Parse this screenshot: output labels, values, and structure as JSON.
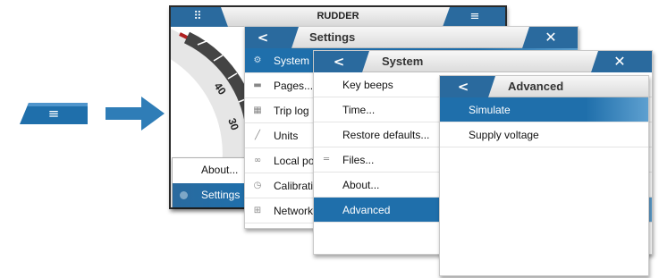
{
  "colors": {
    "accent": "#1f6fab",
    "arrow": "#2f7db7"
  },
  "menu_button": {
    "icon": "menu-icon",
    "glyph": "≡"
  },
  "rudder": {
    "title": "RUDDER",
    "grid_glyph": "⠿",
    "menu_glyph": "≡",
    "gauge_ticks": [
      "40",
      "30"
    ]
  },
  "popup": {
    "items": [
      {
        "label": "About..."
      },
      {
        "label": "Settings"
      }
    ]
  },
  "settings": {
    "title": "Settings",
    "back_glyph": "<",
    "close_glyph": "✕",
    "items": [
      {
        "label": "System",
        "icon": "gear-icon",
        "glyph": "⚙"
      },
      {
        "label": "Pages...",
        "icon": "pages-icon",
        "glyph": "▬"
      },
      {
        "label": "Trip log",
        "icon": "trip-log-icon",
        "glyph": "▦"
      },
      {
        "label": "Units",
        "icon": "ruler-icon",
        "glyph": "╱"
      },
      {
        "label": "Local po",
        "icon": "link-icon",
        "glyph": "∞"
      },
      {
        "label": "Calibratio",
        "icon": "clock-icon",
        "glyph": "◷"
      },
      {
        "label": "Network",
        "icon": "network-icon",
        "glyph": "⊞"
      }
    ]
  },
  "system": {
    "title": "System",
    "back_glyph": "<",
    "close_glyph": "✕",
    "items": [
      {
        "label": "Key beeps",
        "glyph": ""
      },
      {
        "label": "Time...",
        "glyph": ""
      },
      {
        "label": "Restore defaults...",
        "glyph": ""
      },
      {
        "label": "Files...",
        "glyph": "═"
      },
      {
        "label": "About...",
        "glyph": ""
      },
      {
        "label": "Advanced",
        "glyph": ""
      }
    ]
  },
  "advanced": {
    "title": "Advanced",
    "back_glyph": "<",
    "items": [
      {
        "label": "Simulate"
      },
      {
        "label": "Supply voltage"
      }
    ]
  }
}
